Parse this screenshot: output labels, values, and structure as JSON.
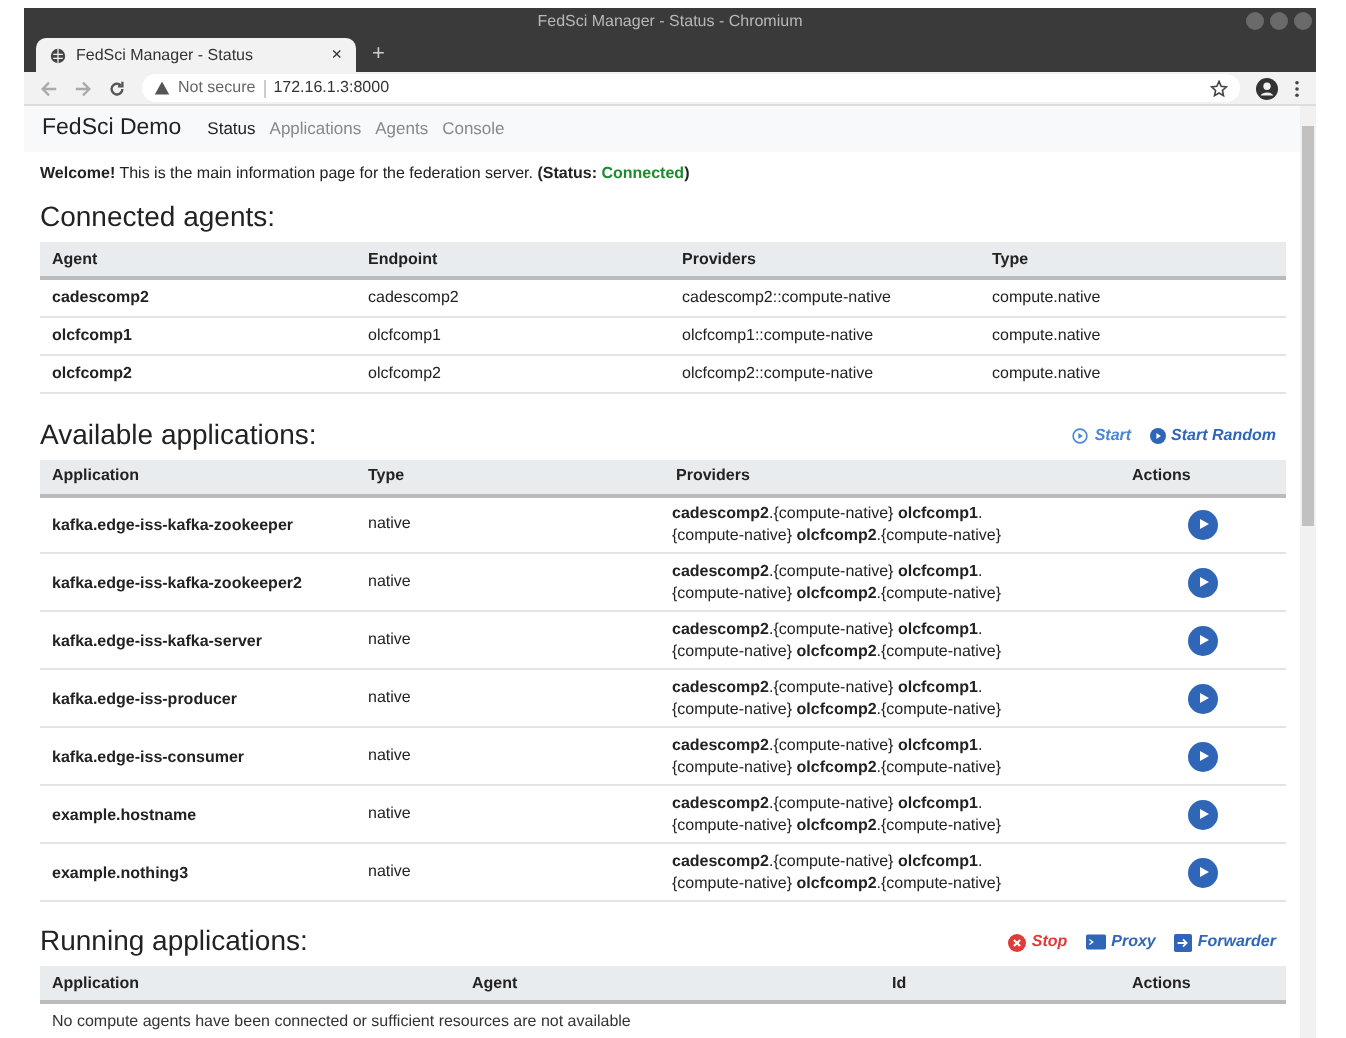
{
  "window": {
    "title": "FedSci Manager - Status - Chromium"
  },
  "browser_tabs": [
    {
      "label": "FedSci Manager - Status",
      "selected": true,
      "close": "×"
    }
  ],
  "new_tab": "+",
  "address_bar": {
    "security": "Not secure",
    "url": "172.16.1.3:8000"
  },
  "navbar": {
    "brand": "FedSci Demo",
    "items": [
      {
        "label": "Status",
        "selected": true
      },
      {
        "label": "Applications",
        "selected": false
      },
      {
        "label": "Agents",
        "selected": false
      },
      {
        "label": "Console",
        "selected": false
      }
    ]
  },
  "welcome": {
    "text": "**Welcome!** This is the main information page for the federation server.",
    "status_prefix": "(Status:",
    "status": "Connected",
    "status_suffix": ")"
  },
  "connected_agents": {
    "title": "Connected agents:",
    "columns": [
      "Agent",
      "Endpoint",
      "Providers",
      "Type"
    ],
    "rows": [
      {
        "agent": "cadescomp2",
        "endpoint": "cadescomp2",
        "providers": "cadescomp2::compute-native",
        "type": "compute.native"
      },
      {
        "agent": "olcfcomp1",
        "endpoint": "olcfcomp1",
        "providers": "olcfcomp1::compute-native",
        "type": "compute.native"
      },
      {
        "agent": "olcfcomp2",
        "endpoint": "olcfcomp2",
        "providers": "olcfcomp2::compute-native",
        "type": "compute.native"
      }
    ]
  },
  "available_applications": {
    "title": "Available applications:",
    "actions": [
      {
        "label": "Start",
        "kind": "start"
      },
      {
        "label": "Start Random",
        "kind": "start_random"
      }
    ],
    "columns": [
      "Application",
      "Type",
      "Providers",
      "Actions"
    ],
    "rows": [
      {
        "application": "kafka.edge-iss-kafka-zookeeper",
        "type": "native",
        "providers": "**cadescomp2**.{compute-native} **olcfcomp1**.{compute-native} **olcfcomp2**.{compute-native}"
      },
      {
        "application": "kafka.edge-iss-kafka-zookeeper2",
        "type": "native",
        "providers": "**cadescomp2**.{compute-native} **olcfcomp1**.{compute-native} **olcfcomp2**.{compute-native}"
      },
      {
        "application": "kafka.edge-iss-kafka-server",
        "type": "native",
        "providers": "**cadescomp2**.{compute-native} **olcfcomp1**.{compute-native} **olcfcomp2**.{compute-native}"
      },
      {
        "application": "kafka.edge-iss-producer",
        "type": "native",
        "providers": "**cadescomp2**.{compute-native} **olcfcomp1**.{compute-native} **olcfcomp2**.{compute-native}"
      },
      {
        "application": "kafka.edge-iss-consumer",
        "type": "native",
        "providers": "**cadescomp2**.{compute-native} **olcfcomp1**.{compute-native} **olcfcomp2**.{compute-native}"
      },
      {
        "application": "example.hostname",
        "type": "native",
        "providers": "**cadescomp2**.{compute-native} **olcfcomp1**.{compute-native} **olcfcomp2**.{compute-native}"
      },
      {
        "application": "example.nothing3",
        "type": "native",
        "providers": "**cadescomp2**.{compute-native} **olcfcomp1**.{compute-native} **olcfcomp2**.{compute-native}"
      }
    ]
  },
  "running_applications": {
    "title": "Running applications:",
    "actions": [
      {
        "label": "Stop",
        "kind": "stop"
      },
      {
        "label": "Proxy",
        "kind": "proxy"
      },
      {
        "label": "Forwarder",
        "kind": "forwarder"
      }
    ],
    "columns": [
      "Application",
      "Agent",
      "Id",
      "Actions"
    ],
    "empty_message": "No compute agents have been connected or sufficient resources are not available"
  }
}
